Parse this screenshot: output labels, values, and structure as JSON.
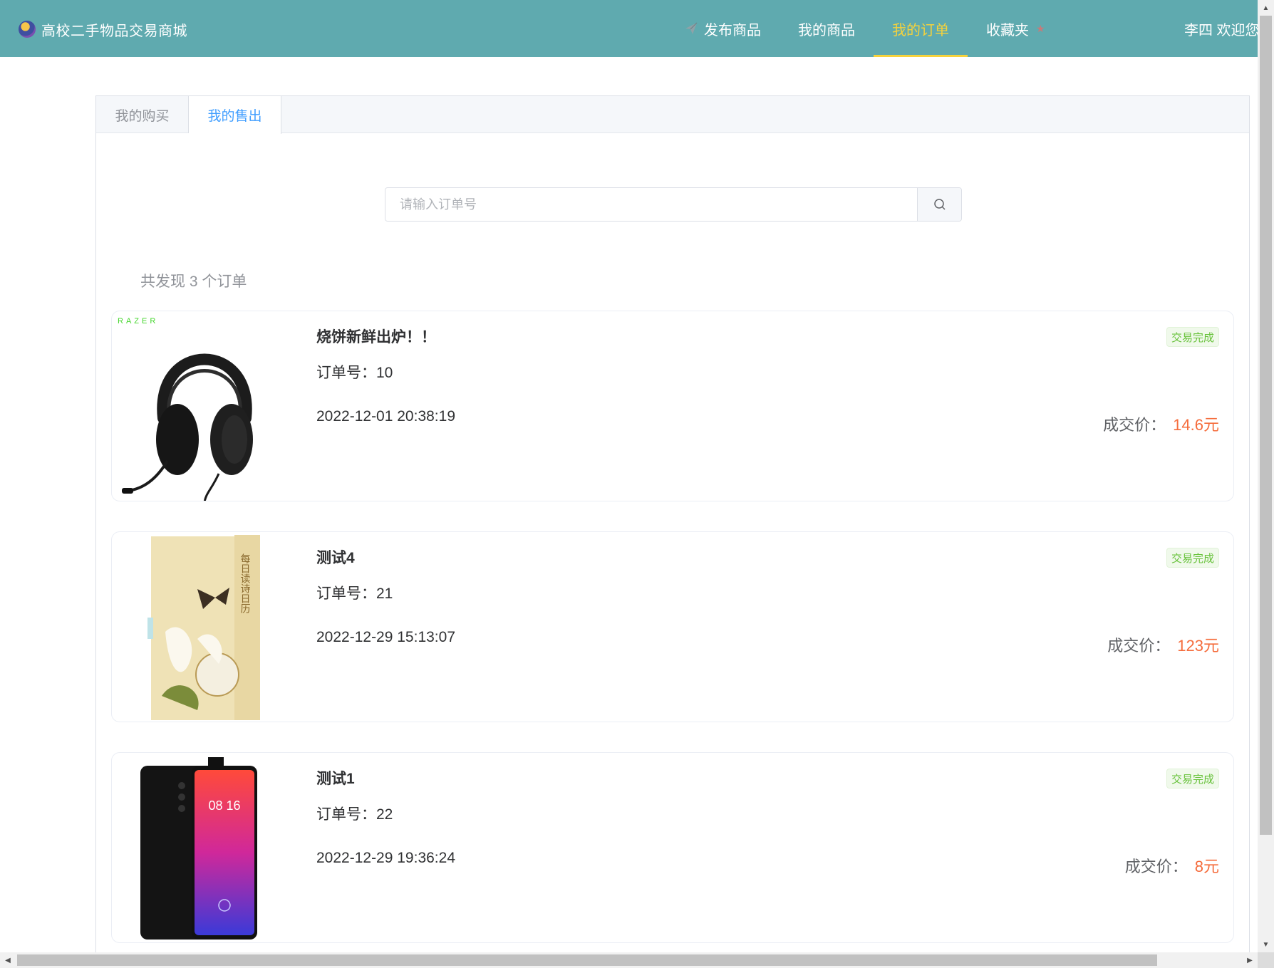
{
  "header": {
    "brand_title": "高校二手物品交易商城",
    "nav": [
      {
        "label": "发布商品",
        "icon": "paper-plane-icon",
        "active": false
      },
      {
        "label": "我的商品",
        "active": false
      },
      {
        "label": "我的订单",
        "active": true
      },
      {
        "label": "收藏夹",
        "icon": "star-icon",
        "active": false
      }
    ],
    "welcome": "李四 欢迎您"
  },
  "tabs": [
    {
      "label": "我的购买",
      "active": false
    },
    {
      "label": "我的售出",
      "active": true
    }
  ],
  "search": {
    "placeholder": "请输入订单号",
    "value": "",
    "icon": "search-icon"
  },
  "summary": "共发现 3 个订单",
  "orders": [
    {
      "title": "烧饼新鲜出炉！！",
      "order_no": "订单号：10",
      "time": "2022-12-01 20:38:19",
      "status": "交易完成",
      "price_label": "成交价：",
      "price_value": "14.6元",
      "image": "headphones-image",
      "image_text": "RAZER"
    },
    {
      "title": "测试4",
      "order_no": "订单号：21",
      "time": "2022-12-29 15:13:07",
      "status": "交易完成",
      "price_label": "成交价：",
      "price_value": "123元",
      "image": "poetry-calendar-book-image",
      "image_text": "每日读诗日历"
    },
    {
      "title": "测试1",
      "order_no": "订单号：22",
      "time": "2022-12-29 19:36:24",
      "status": "交易完成",
      "price_label": "成交价：",
      "price_value": "8元",
      "image": "smartphone-image",
      "image_text": "08 16"
    }
  ],
  "colors": {
    "header_bg": "#5faaaf",
    "nav_active": "#f5d23c",
    "tab_active": "#409eff",
    "status_green": "#67c23a",
    "price_orange": "#f56c3c"
  }
}
